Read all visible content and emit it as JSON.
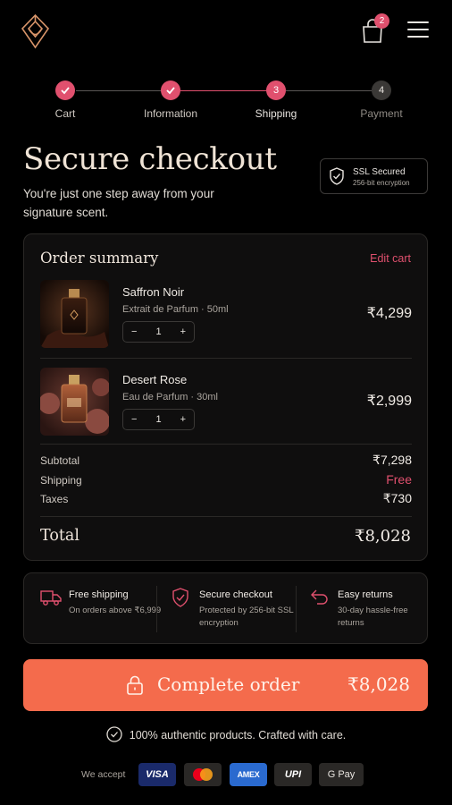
{
  "header": {
    "cart_count": "2"
  },
  "stepper": {
    "steps": [
      {
        "label": "Cart",
        "state": "done",
        "number": ""
      },
      {
        "label": "Information",
        "state": "done",
        "number": ""
      },
      {
        "label": "Shipping",
        "state": "current",
        "number": "3"
      },
      {
        "label": "Payment",
        "state": "todo",
        "number": "4"
      }
    ]
  },
  "hero": {
    "title": "Secure checkout",
    "subtitle": "You're just one step away from your signature scent.",
    "ssl_title": "SSL Secured",
    "ssl_sub": "256-bit encryption"
  },
  "order": {
    "title": "Order summary",
    "edit_label": "Edit cart",
    "items": [
      {
        "name": "Saffron Noir",
        "desc": "Extrait de Parfum · 50ml",
        "qty": "1",
        "price": "₹4,299",
        "minus": "−",
        "plus": "+"
      },
      {
        "name": "Desert Rose",
        "desc": "Eau de Parfum · 30ml",
        "qty": "1",
        "price": "₹2,999",
        "minus": "−",
        "plus": "+"
      }
    ],
    "subtotal_label": "Subtotal",
    "subtotal": "₹7,298",
    "shipping_label": "Shipping",
    "shipping": "Free",
    "taxes_label": "Taxes",
    "taxes": "₹730",
    "total_label": "Total",
    "total": "₹8,028"
  },
  "features": [
    {
      "title": "Free shipping",
      "sub": "On orders above ₹6,999",
      "icon": "truck-icon"
    },
    {
      "title": "Secure checkout",
      "sub": "Protected by 256-bit SSL encryption",
      "icon": "shield-check-icon"
    },
    {
      "title": "Easy returns",
      "sub": "30-day hassle-free returns",
      "icon": "return-arrow-icon"
    }
  ],
  "cta": {
    "label": "Complete order",
    "price": "₹8,028"
  },
  "footer": {
    "authentic": "100% authentic products. Crafted with care.",
    "we_accept": "We accept",
    "payments": [
      "VISA",
      "Mastercard",
      "AMEX",
      "UPI",
      "G Pay"
    ]
  },
  "colors": {
    "accent": "#e0506e",
    "cta": "#f46b4c",
    "background": "#000000",
    "card": "#0f0e0e"
  }
}
